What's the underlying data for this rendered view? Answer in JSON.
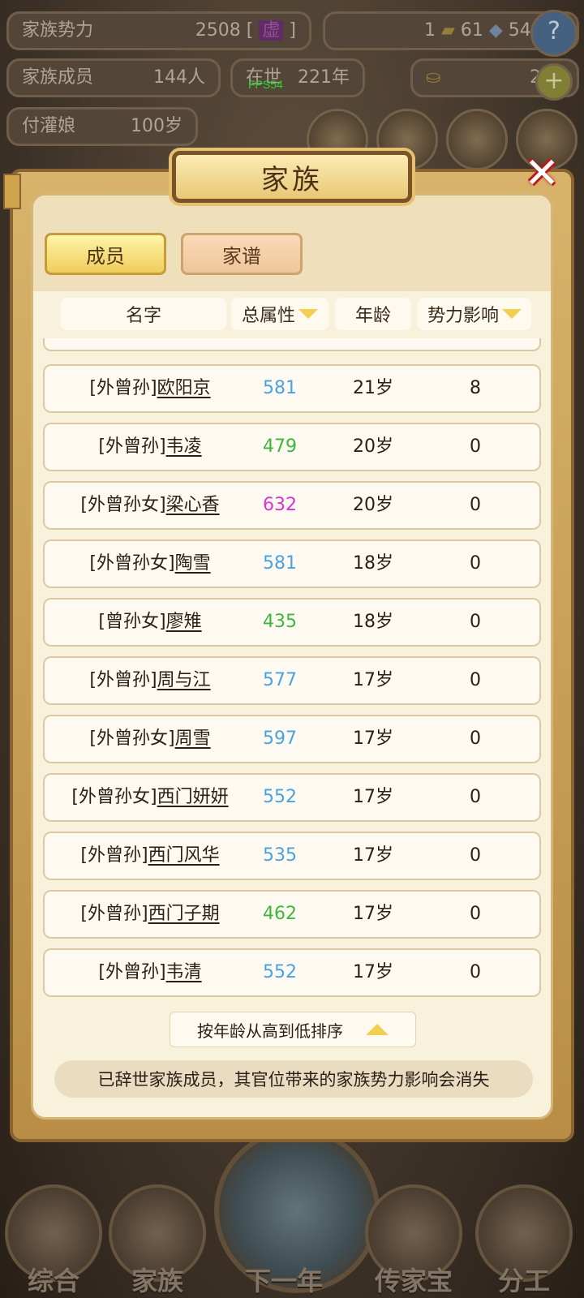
{
  "top_stats": {
    "power_label": "家族势力",
    "power_value": "2508",
    "power_bracket_open": "[",
    "power_rank": "虚",
    "power_bracket_close": "]",
    "gold_count": "1",
    "silk_count": "61",
    "coin_count": "543",
    "members_label": "家族成员",
    "members_value": "144人",
    "era_label": "在世",
    "era_value": "221年",
    "ingot_count": "2",
    "elder_label": "付灌娘",
    "elder_value": "100岁",
    "fps": "FPS54"
  },
  "dialog": {
    "title": "家族",
    "close_icon": "✕",
    "tabs": [
      {
        "label": "成员",
        "active": true
      },
      {
        "label": "家谱",
        "active": false
      }
    ],
    "columns": {
      "name": "名字",
      "total_attr": "总属性",
      "age": "年龄",
      "influence": "势力影响"
    },
    "rows": [
      {
        "title": "[外曾孙]",
        "name": "欧阳京",
        "attr": "581",
        "attr_color": "#4aa3e0",
        "age": "21岁",
        "influence": "8"
      },
      {
        "title": "[外曾孙]",
        "name": "韦凌",
        "attr": "479",
        "attr_color": "#3cb83c",
        "age": "20岁",
        "influence": "0"
      },
      {
        "title": "[外曾孙女]",
        "name": "梁心香",
        "attr": "632",
        "attr_color": "#d932d4",
        "age": "20岁",
        "influence": "0"
      },
      {
        "title": "[外曾孙女]",
        "name": "陶雪",
        "attr": "581",
        "attr_color": "#4aa3e0",
        "age": "18岁",
        "influence": "0"
      },
      {
        "title": "[曾孙女]",
        "name": "廖雉",
        "attr": "435",
        "attr_color": "#3cb83c",
        "age": "18岁",
        "influence": "0"
      },
      {
        "title": "[外曾孙]",
        "name": "周与江",
        "attr": "577",
        "attr_color": "#4aa3e0",
        "age": "17岁",
        "influence": "0"
      },
      {
        "title": "[外曾孙女]",
        "name": "周雪",
        "attr": "597",
        "attr_color": "#4aa3e0",
        "age": "17岁",
        "influence": "0"
      },
      {
        "title": "[外曾孙女]",
        "name": "西门妍妍",
        "attr": "552",
        "attr_color": "#4aa3e0",
        "age": "17岁",
        "influence": "0"
      },
      {
        "title": "[外曾孙]",
        "name": "西门风华",
        "attr": "535",
        "attr_color": "#4aa3e0",
        "age": "17岁",
        "influence": "0"
      },
      {
        "title": "[外曾孙]",
        "name": "西门子期",
        "attr": "462",
        "attr_color": "#3cb83c",
        "age": "17岁",
        "influence": "0"
      },
      {
        "title": "[外曾孙]",
        "name": "韦清",
        "attr": "552",
        "attr_color": "#4aa3e0",
        "age": "17岁",
        "influence": "0"
      }
    ],
    "sort_button": "按年龄从高到低排序",
    "notice": "已辞世家族成员，其官位带来的家族势力影响会消失"
  },
  "bottom_nav": [
    {
      "label": "综合"
    },
    {
      "label": "家族"
    },
    {
      "label": "下一年"
    },
    {
      "label": "传家宝"
    },
    {
      "label": "分工"
    }
  ],
  "colors": {
    "attr_blue": "#4aa3e0",
    "attr_green": "#3cb83c",
    "attr_magenta": "#d932d4",
    "panel_gold": "#d8b36a"
  }
}
